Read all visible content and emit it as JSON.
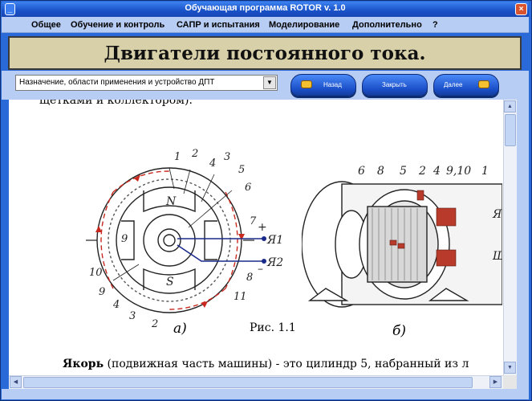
{
  "window": {
    "title": "Обучающая программа ROTOR  v. 1.0",
    "min_label": "_",
    "close_label": "×"
  },
  "menu": {
    "items": [
      "Общее",
      "Обучение и контроль",
      "САПР и испытания",
      "Моделирование",
      "Дополнительно",
      "?"
    ]
  },
  "header": {
    "title": "Двигатели постоянного тока."
  },
  "toolbar": {
    "topic_select_value": "Назначение, области применения и устройство ДПТ",
    "back_label": "Назад",
    "close_label": "Закрыть",
    "next_label": "Далее"
  },
  "content": {
    "cut_line": "щётками и коллектором).",
    "figure_caption": "Рис. 1.1",
    "left_sublabel": "а)",
    "right_sublabel": "б)",
    "paragraph_bold": "Якорь",
    "paragraph_rest": " (подвижная часть машины)  -  это  цилиндр 5,  набранный из л",
    "left_figure": {
      "numbers": [
        "1",
        "2",
        "3",
        "4",
        "5",
        "6",
        "7",
        "8",
        "9",
        "10",
        "11",
        "4",
        "3",
        "2",
        "9"
      ],
      "pole_labels": [
        "N",
        "S"
      ],
      "terminals": [
        "Я1",
        "Я2"
      ],
      "signs": [
        "+",
        "–"
      ]
    },
    "right_figure": {
      "numbers": [
        "6",
        "8",
        "5",
        "2",
        "4",
        "9,10",
        "1"
      ],
      "side_text": [
        "Я",
        "Ш"
      ]
    }
  },
  "colors": {
    "title_bar": "#1a52c8",
    "menu_bg": "#b7cdf3",
    "header_bg": "#d8d0a8",
    "button_blue": "#1a4fc8",
    "flux_arrows": "#c8281e",
    "wiring": "#1a2a8a"
  }
}
